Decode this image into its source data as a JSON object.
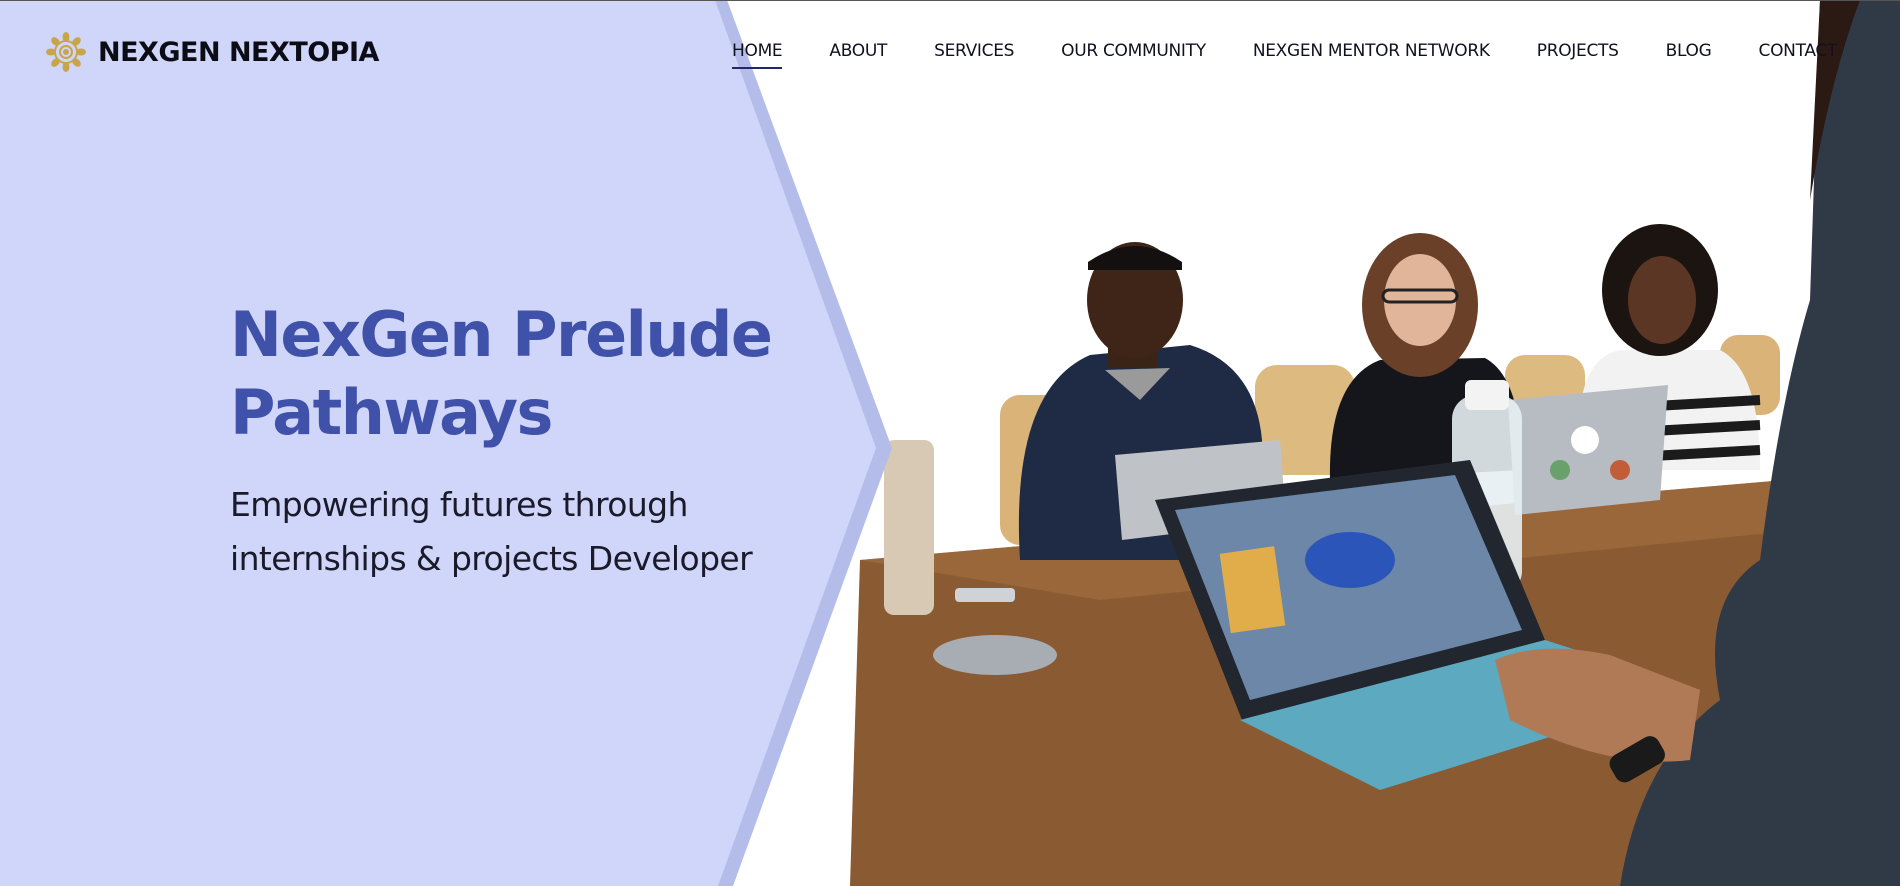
{
  "brand": {
    "name": "NEXGEN NEXTOPIA",
    "logo_icon": "gold-mandala-logo-icon"
  },
  "nav": {
    "items": [
      {
        "label": "HOME",
        "active": true
      },
      {
        "label": "ABOUT",
        "active": false
      },
      {
        "label": "SERVICES",
        "active": false
      },
      {
        "label": "OUR COMMUNITY",
        "active": false
      },
      {
        "label": "NEXGEN MENTOR NETWORK",
        "active": false
      },
      {
        "label": "PROJECTS",
        "active": false
      },
      {
        "label": "BLOG",
        "active": false
      },
      {
        "label": "CONTACT",
        "active": false
      }
    ]
  },
  "hero": {
    "title": "NexGen Prelude Pathways",
    "subtitle": "Empowering futures through internships & projects Developer",
    "image": "photo-team-meeting-with-laptops"
  },
  "colors": {
    "panel": "#cfd6f9",
    "panel_edge": "#b4bde9",
    "title": "#3f51a8",
    "nav_active_underline": "#22266a",
    "logo_gold": "#c9a54a"
  }
}
